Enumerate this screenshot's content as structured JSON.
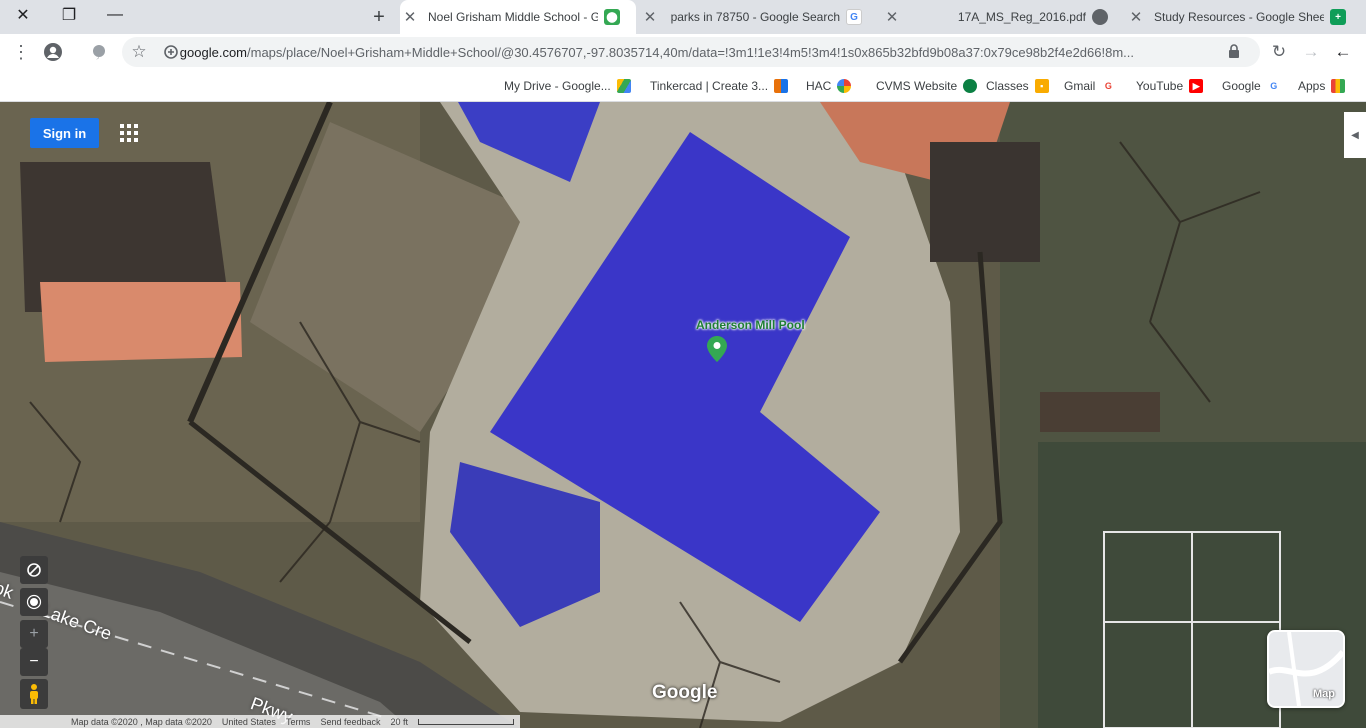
{
  "browser": {
    "tabs": [
      {
        "title": "Study Resources - Google Sheets",
        "favicon": "sheets-icon",
        "color": "#0f9d58"
      },
      {
        "title": "17A_MS_Reg_2016.pdf",
        "favicon": "pdf-icon",
        "color": "#5f6368"
      },
      {
        "title": "parks in 78750 - Google Search",
        "favicon": "google-icon",
        "color": "#4285f4"
      },
      {
        "title": "Noel Grisham Middle School - G",
        "favicon": "maps-icon",
        "color": "#34a853",
        "active": true
      }
    ],
    "url_host": "google.com",
    "url_path": "/maps/place/Noel+Grisham+Middle+School/@30.4576707,-97.8035714,40m/data=!3m1!1e3!4m5!3m4!1s0x865b32bfd9b08a37:0x79ce98b2f4e2d66!8m..."
  },
  "bookmarks": [
    {
      "label": "Apps",
      "icon": "apps-icon",
      "color": "#ea4335"
    },
    {
      "label": "Google",
      "icon": "google-icon",
      "color": "#4285f4"
    },
    {
      "label": "YouTube",
      "icon": "youtube-icon",
      "color": "#ff0000"
    },
    {
      "label": "Gmail",
      "icon": "gmail-icon",
      "color": "#ea4335"
    },
    {
      "label": "Classes",
      "icon": "classroom-icon",
      "color": "#f9ab00"
    },
    {
      "label": "CVMS Website",
      "icon": "school-icon",
      "color": "#0b8043"
    },
    {
      "label": "HAC",
      "icon": "hac-icon",
      "color": "#673ab7"
    },
    {
      "label": "Tinkercad | Create 3...",
      "icon": "tinkercad-icon",
      "color": "#e8710a"
    },
    {
      "label": "My Drive - Google...",
      "icon": "drive-icon",
      "color": "#1a73e8"
    }
  ],
  "map": {
    "sign_in": "Sign in",
    "place_name": "Anderson Mill Pool",
    "road_labels": [
      "Lake Cre",
      "Pkwy",
      "pk"
    ],
    "logo": "Google",
    "layer_switch_label": "Map",
    "footer": {
      "scale": "20 ft",
      "feedback": "Send feedback",
      "terms": "Terms",
      "region": "United States",
      "data": "Map data ©2020 , Map data ©2020"
    }
  },
  "colors": {
    "accent": "#1a73e8",
    "pool_cover": "#3a36c8",
    "pin": "#34a853"
  }
}
